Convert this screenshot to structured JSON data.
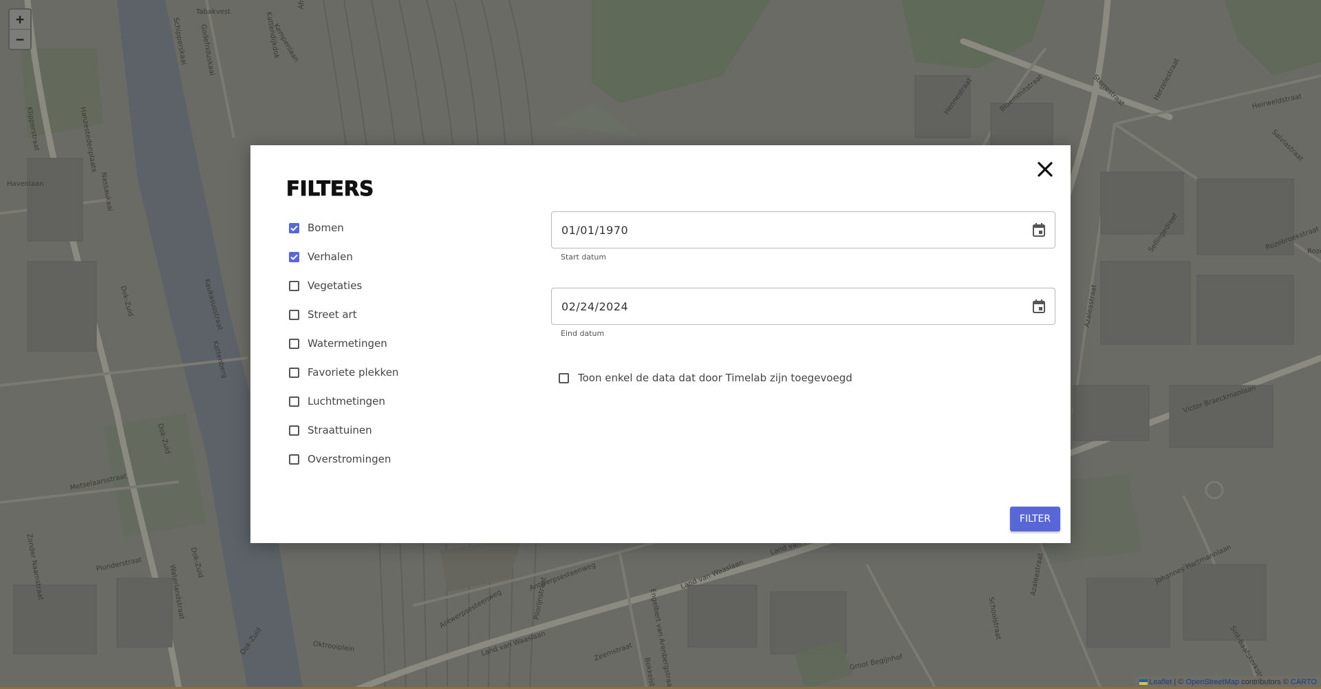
{
  "map": {
    "zoom_in_label": "+",
    "zoom_out_label": "−",
    "streets": [
      "Tabakvest",
      "Schipperskaai",
      "Kattendijkdok",
      "Godefriduskaai",
      "Kempenlaan",
      "Afrikalaan",
      "Klipperstraat",
      "Hanzestedenplaats",
      "Nassaukaai",
      "Kaukasusstraat",
      "Havenlaan",
      "Dok-Zuid",
      "Dok-Zuid",
      "Dok-Zuid",
      "Dok-Zuid",
      "Kattenberg",
      "Metselaarsstraat",
      "Zonder Naamstraat",
      "Plunderstraat",
      "Waterlandstraat",
      "Oktrooiplein",
      "Antwerpsesteenweg",
      "Antwerpsesteenweg",
      "Land van Waaslaan",
      "Land van Waaslaan",
      "Land van Waaslaan",
      "Pilorijnstraat",
      "Zeemstraat",
      "Bokkelstraat",
      "Engelbert van Arenbergstraat",
      "Groot Begijnhof",
      "Schoolstraat",
      "Azaleastraat",
      "Johannes Hartmannlaan",
      "Sint-Baafskerkstraat",
      "Victor Braeckmanlaan",
      "Rozebroekstraat",
      "Sellingedreef",
      "Hennestraat",
      "Heirweldstraat",
      "Salviastraat",
      "Bloemmitstraat",
      "Sterrestraat",
      "Herzelestraat",
      "Azaleastraat",
      "Hanzestraat",
      "Kiellaan",
      "Roze"
    ],
    "attribution": {
      "leaflet": "Leaflet",
      "sep": "|",
      "copy": "©",
      "osm": "OpenStreetMap",
      "contrib": "contributors ©",
      "carto": "CARTO"
    }
  },
  "modal": {
    "title": "FILTERS",
    "close_icon": "close-icon",
    "categories": [
      {
        "label": "Bomen",
        "checked": true
      },
      {
        "label": "Verhalen",
        "checked": true
      },
      {
        "label": "Vegetaties",
        "checked": false
      },
      {
        "label": "Street art",
        "checked": false
      },
      {
        "label": "Watermetingen",
        "checked": false
      },
      {
        "label": "Favoriete plekken",
        "checked": false
      },
      {
        "label": "Luchtmetingen",
        "checked": false
      },
      {
        "label": "Straattuinen",
        "checked": false
      },
      {
        "label": "Overstromingen",
        "checked": false
      }
    ],
    "start_date": {
      "value": "01/01/1970",
      "helper": "Start datum",
      "icon": "calendar-icon"
    },
    "end_date": {
      "value": "02/24/2024",
      "helper": "Eind datum",
      "icon": "calendar-icon"
    },
    "timelab_only": {
      "label": "Toon enkel de data dat door Timelab zijn toegevoegd",
      "checked": false
    },
    "filter_button": "FILTER",
    "accent_color": "#5866d6"
  }
}
